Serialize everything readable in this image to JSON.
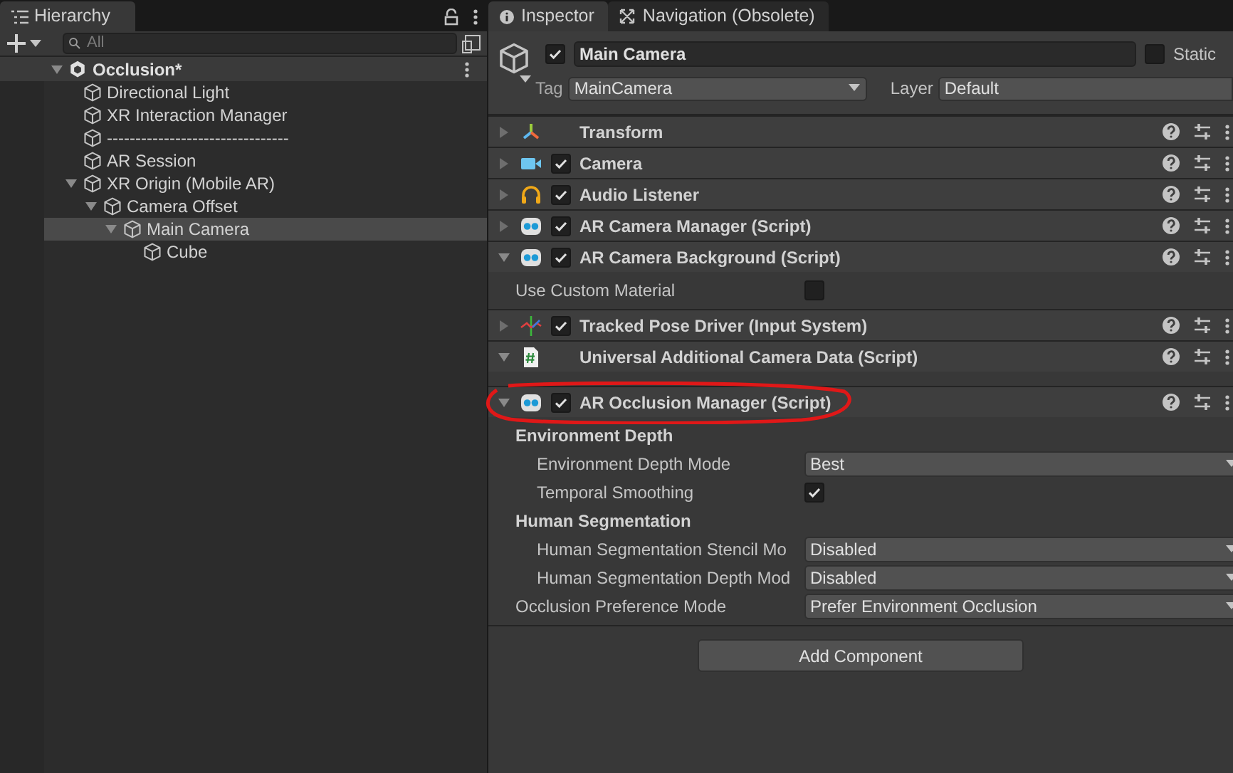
{
  "hierarchy": {
    "tab": {
      "label": "Hierarchy",
      "selected": true
    },
    "search": {
      "placeholder": "All"
    },
    "scene": {
      "name": "Occlusion*",
      "expanded": true,
      "children": [
        {
          "name": "Directional Light",
          "selected": false
        },
        {
          "name": "XR Interaction Manager",
          "selected": false
        },
        {
          "name": "--------------------------------",
          "selected": false
        },
        {
          "name": "AR Session",
          "selected": false
        },
        {
          "name": "XR Origin (Mobile AR)",
          "selected": false,
          "expanded": true,
          "children": [
            {
              "name": "Camera Offset",
              "selected": false,
              "expanded": true,
              "children": [
                {
                  "name": "Main Camera",
                  "selected": true,
                  "expanded": true,
                  "children": [
                    {
                      "name": "Cube",
                      "selected": false
                    }
                  ]
                }
              ]
            }
          ]
        }
      ]
    }
  },
  "inspector": {
    "tabs": [
      {
        "label": "Inspector",
        "kind": "info",
        "selected": true
      },
      {
        "label": "Navigation (Obsolete)",
        "kind": "navigation",
        "selected": false
      }
    ],
    "object": {
      "active": true,
      "name": "Main Camera",
      "static": false,
      "static_label": "Static",
      "tag_label": "Tag",
      "tag": "MainCamera",
      "layer_label": "Layer",
      "layer": "Default"
    },
    "components": [
      {
        "name": "Transform",
        "kind": "transform",
        "expanded": false
      },
      {
        "name": "Camera",
        "kind": "camera",
        "expanded": false,
        "enabled": true
      },
      {
        "name": "Audio Listener",
        "kind": "audio",
        "expanded": false,
        "enabled": true
      },
      {
        "name": "AR Camera Manager (Script)",
        "kind": "ar-script",
        "expanded": false,
        "enabled": true
      },
      {
        "name": "AR Camera Background (Script)",
        "kind": "ar-script",
        "expanded": true,
        "enabled": true,
        "fields": [
          {
            "kind": "checkbox",
            "label": "Use Custom Material",
            "checked": false
          }
        ]
      },
      {
        "name": "Tracked Pose Driver (Input System)",
        "kind": "tracked",
        "expanded": false,
        "enabled": true
      },
      {
        "name": "Universal Additional Camera Data (Script)",
        "kind": "script",
        "expanded": true
      },
      {
        "name": "AR Occlusion Manager (Script)",
        "kind": "ar-script",
        "expanded": true,
        "enabled": true,
        "annotated": true,
        "fields": [
          {
            "kind": "heading",
            "label": "Environment Depth",
            "children": [
              {
                "kind": "dropdown",
                "label": "Environment Depth Mode",
                "value": "Best"
              },
              {
                "kind": "checkbox",
                "label": "Temporal Smoothing",
                "checked": true
              }
            ]
          },
          {
            "kind": "heading",
            "label": "Human Segmentation",
            "children": [
              {
                "kind": "dropdown",
                "label": "Human Segmentation Stencil Mo",
                "value": "Disabled"
              },
              {
                "kind": "dropdown",
                "label": "Human Segmentation Depth Mod",
                "value": "Disabled"
              }
            ]
          },
          {
            "kind": "dropdown",
            "label": "Occlusion Preference Mode",
            "value": "Prefer Environment Occlusion"
          }
        ]
      }
    ],
    "add_button": "Add Component"
  }
}
